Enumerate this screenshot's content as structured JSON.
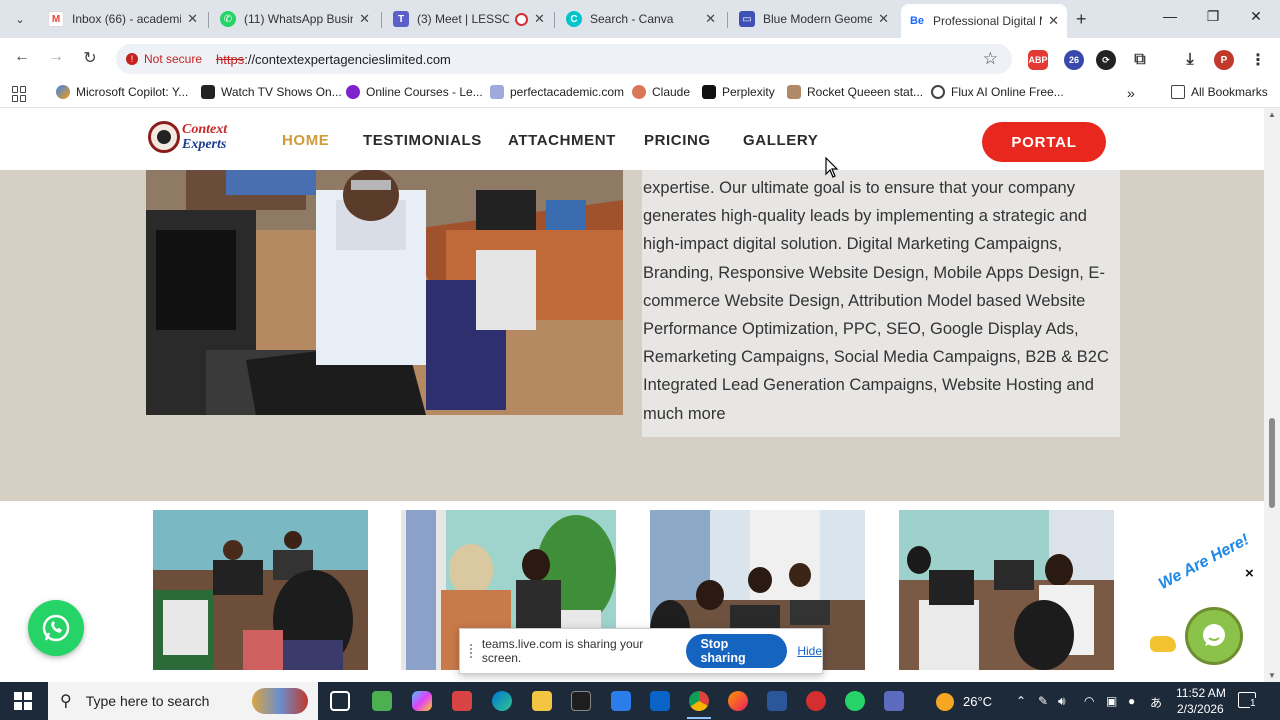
{
  "tabs": [
    {
      "title": "Inbox (66) - academic",
      "icon": "gmail-icon"
    },
    {
      "title": "(11) WhatsApp Busin",
      "icon": "whatsapp-icon"
    },
    {
      "title": "(3) Meet | LESSO",
      "icon": "teams-icon"
    },
    {
      "title": "Search - Canva",
      "icon": "canva-icon"
    },
    {
      "title": "Blue Modern Geome",
      "icon": "slides-icon"
    },
    {
      "title": "Professional Digital M",
      "icon": "behance-icon",
      "active": true
    }
  ],
  "toolbar": {
    "security_label": "Not secure",
    "url_scheme": "https",
    "url_rest": "://contextexpertagencieslimited.com",
    "profile_initial": "P",
    "ext_badge": "26",
    "abp_label": "ABP"
  },
  "bookmarks": {
    "items": [
      "Microsoft Copilot: Y...",
      "Watch TV Shows On...",
      "Online Courses - Le...",
      "perfectacademic.com",
      "Claude",
      "Perplexity",
      "Rocket Queeen stat...",
      "Flux AI Online Free..."
    ],
    "overflow": "»",
    "all_label": "All Bookmarks"
  },
  "site": {
    "logo_line1": "Context",
    "logo_line2": "Experts",
    "nav": [
      "HOME",
      "TESTIMONIALS",
      "ATTACHMENT",
      "PRICING",
      "GALLERY"
    ],
    "portal_label": "PORTAL",
    "body_text": "expertise. Our ultimate goal is to ensure that your company generates high-quality leads by implementing a strategic and high-impact digital solution. Digital Marketing Campaigns, Branding, Responsive Website Design, Mobile Apps Design, E-commerce Website Design, Attribution Model based Website Performance Optimization, PPC, SEO, Google Display Ads, Remarketing Campaigns, Social Media Campaigns, B2B & B2C Integrated Lead Generation Campaigns, Website Hosting and much more"
  },
  "chat_widget": {
    "label": "We Are Here!",
    "close": "×"
  },
  "share_bar": {
    "message": "teams.live.com is sharing your screen.",
    "stop_label": "Stop sharing",
    "hide_label": "Hide"
  },
  "taskbar": {
    "search_placeholder": "Type here to search",
    "temperature": "26°C",
    "time": "11:52 AM",
    "date": "2/3/2026",
    "notification_count": "1"
  }
}
